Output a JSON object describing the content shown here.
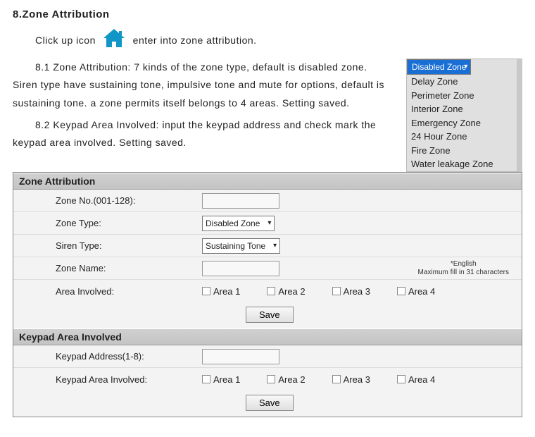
{
  "heading": "8.Zone Attribution",
  "intro_before": "Click up icon",
  "intro_after": "enter into zone attribution.",
  "para81": "8.1 Zone Attribution: 7 kinds of the zone type, default is disabled zone. Siren type have sustaining tone, impulsive tone and mute for options, default is sustaining tone. a zone permits itself belongs to 4 areas. Setting saved.",
  "para82": "8.2 Keypad Area Involved: input the keypad address and check mark the keypad area involved. Setting saved.",
  "zone_types": {
    "selected": "Disabled Zone",
    "o1": "Delay Zone",
    "o2": "Perimeter Zone",
    "o3": "Interior Zone",
    "o4": "Emergency Zone",
    "o5": "24 Hour Zone",
    "o6": "Fire Zone",
    "o7": "Water leakage Zone"
  },
  "panel": {
    "hdr1": "Zone Attribution",
    "zone_no_label": "Zone No.(001-128):",
    "zone_type_label": "Zone Type:",
    "zone_type_value": "Disabled Zone",
    "siren_label": "Siren Type:",
    "siren_value": "Sustaining Tone",
    "zone_name_label": "Zone Name:",
    "hint1": "*English",
    "hint2": "Maximum fill in 31 characters",
    "area_involved_label": "Area Involved:",
    "area1": "Area 1",
    "area2": "Area 2",
    "area3": "Area 3",
    "area4": "Area 4",
    "save": "Save",
    "hdr2": "Keypad Area Involved",
    "keypad_addr_label": "Keypad Address(1-8):",
    "keypad_area_label": "Keypad Area Involved:"
  }
}
